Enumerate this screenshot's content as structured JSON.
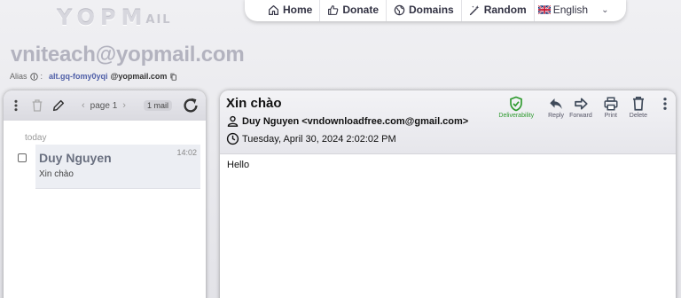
{
  "logo": {
    "big": "YOPM",
    "small": "AIL"
  },
  "nav": {
    "home": "Home",
    "donate": "Donate",
    "domains": "Domains",
    "random": "Random",
    "language": "English"
  },
  "inbox": {
    "email": "vniteach@yopmail.com",
    "alias_label": "Alias",
    "alias_local": "alt.gq-fomy0yqi",
    "alias_domain": "@yopmail.com"
  },
  "list": {
    "page": "page 1",
    "count": "1 mail",
    "group": "today",
    "items": [
      {
        "from": "Duy Nguyen",
        "subject": "Xin chào",
        "time": "14:02"
      }
    ]
  },
  "message": {
    "subject": "Xin chào",
    "from": "Duy Nguyen <vndownloadfree.com@gmail.com>",
    "date": "Tuesday, April 30, 2024 2:02:02 PM",
    "body": "Hello",
    "actions": {
      "deliverability": "Deliverability",
      "reply": "Reply",
      "forward": "Forward",
      "print": "Print",
      "delete": "Delete"
    }
  },
  "colors": {
    "deliverability": "#2e9a2e",
    "alias": "#5060a8",
    "email_title": "#b3b3bf"
  }
}
